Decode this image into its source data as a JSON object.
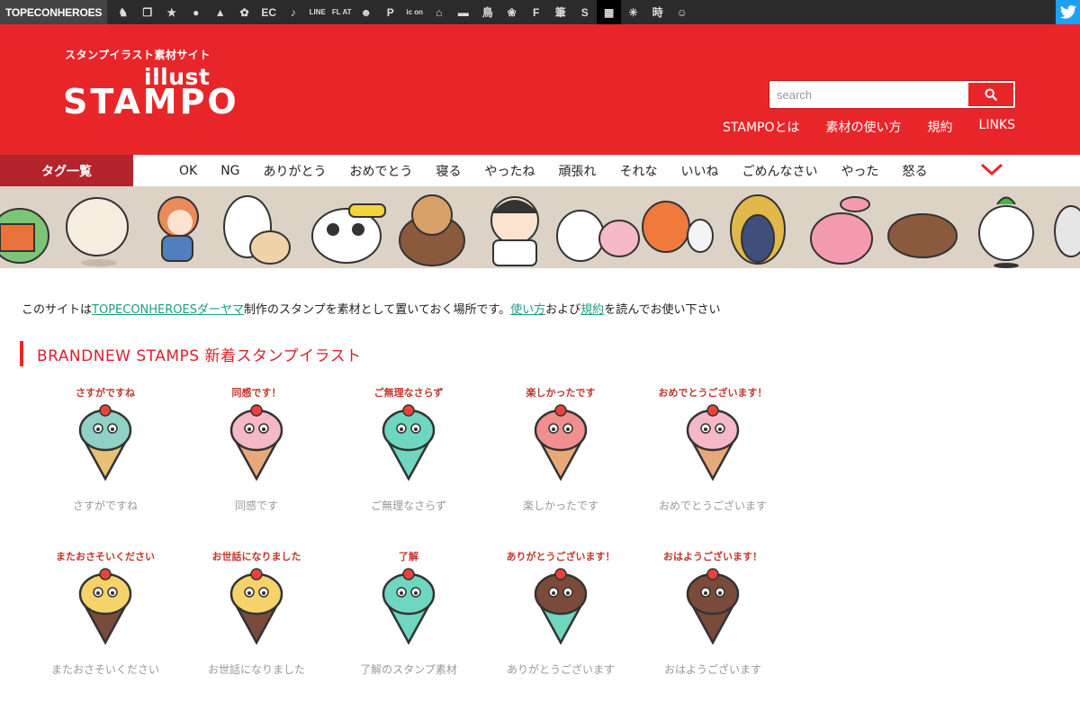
{
  "topbar": {
    "brand": "TOPECONHEROES",
    "site_icons": [
      {
        "icon": "animal-icon",
        "glyph": "♞"
      },
      {
        "icon": "copy-icon",
        "glyph": "❐"
      },
      {
        "icon": "person-icon",
        "glyph": "★"
      },
      {
        "icon": "speech-icon",
        "glyph": "●"
      },
      {
        "icon": "bird-icon",
        "glyph": "▲"
      },
      {
        "icon": "flower-icon",
        "glyph": "✿"
      },
      {
        "icon": "ec-icon",
        "glyph": "EC"
      },
      {
        "icon": "music-icon",
        "glyph": "♪"
      },
      {
        "icon": "line-icon",
        "glyph": "LINE"
      },
      {
        "icon": "flat-icon",
        "glyph": "FL AT"
      },
      {
        "icon": "smile-icon",
        "glyph": "☻"
      },
      {
        "icon": "parking-icon",
        "glyph": "P"
      },
      {
        "icon": "icon-text-icon",
        "glyph": "ic on"
      },
      {
        "icon": "building-icon",
        "glyph": "⌂"
      },
      {
        "icon": "train-icon",
        "glyph": "▬"
      },
      {
        "icon": "bird-kanji-icon",
        "glyph": "鳥"
      },
      {
        "icon": "flower-badge-icon",
        "glyph": "❀"
      },
      {
        "icon": "f-icon",
        "glyph": "F"
      },
      {
        "icon": "brush-icon",
        "glyph": "筆"
      },
      {
        "icon": "s-icon",
        "glyph": "S"
      },
      {
        "icon": "grid-icon",
        "glyph": "▦"
      },
      {
        "icon": "sparkle-icon",
        "glyph": "✳"
      },
      {
        "icon": "time-kanji-icon",
        "glyph": "時"
      },
      {
        "icon": "face-icon",
        "glyph": "☺"
      }
    ],
    "active_index": 20
  },
  "header": {
    "tagline": "スタンプイラスト素材サイト",
    "logo_small": "illust",
    "logo_large": "STAMPO",
    "search_placeholder": "search",
    "nav": [
      "STAMPOとは",
      "素材の使い方",
      "規約",
      "LINKS"
    ]
  },
  "tags": {
    "title": "タグ一覧",
    "items": [
      "OK",
      "NG",
      "ありがとう",
      "おめでとう",
      "寝る",
      "やったね",
      "頑張れ",
      "それな",
      "いいね",
      "ごめんなさい",
      "やった",
      "怒る"
    ]
  },
  "intro": {
    "before": "このサイトは",
    "link1": "TOPECONHEROESダーヤマ",
    "mid1": "制作のスタンプを素材として置いておく場所です。",
    "link2": "使い方",
    "mid2": "および",
    "link3": "規約",
    "after": "を読んでお使い下さい"
  },
  "section": {
    "title": "BRANDNEW STAMPS 新着スタンプイラスト"
  },
  "stamps": [
    {
      "caption": "さすがですね",
      "bubble": "さすがですね",
      "cream": "#8fd1c4",
      "cone": "#e8c07a"
    },
    {
      "caption": "同感です",
      "bubble": "同感です！",
      "cream": "#f5b8c6",
      "cone": "#e8a97a"
    },
    {
      "caption": "ご無理なさらず",
      "bubble": "ご無理なさらず",
      "cream": "#6fd6c0",
      "cone": "#6fd6c0"
    },
    {
      "caption": "楽しかったです",
      "bubble": "楽しかったです",
      "cream": "#f08f8f",
      "cone": "#e8a97a"
    },
    {
      "caption": "おめでとうございます",
      "bubble": "おめでとうございます！",
      "cream": "#f5b8c6",
      "cone": "#e8a97a"
    },
    {
      "caption": "またおさそいください",
      "bubble": "またおさそいください",
      "cream": "#f5d36a",
      "cone": "#7a4a3a"
    },
    {
      "caption": "お世話になりました",
      "bubble": "お世話になりました",
      "cream": "#f5d36a",
      "cone": "#7a4a3a"
    },
    {
      "caption": "了解のスタンプ素材",
      "bubble": "了解",
      "cream": "#6fd6c0",
      "cone": "#6fd6c0"
    },
    {
      "caption": "ありがとうございます",
      "bubble": "ありがとうございます！",
      "cream": "#7a4a3a",
      "cone": "#6fd6c0"
    },
    {
      "caption": "おはようございます",
      "bubble": "おはようございます！",
      "cream": "#7a4a3a",
      "cone": "#7a4a3a"
    }
  ],
  "colors": {
    "brand_red": "#e8262a",
    "tag_red": "#b5232c",
    "banner_bg": "#dcd2c6",
    "link_green": "#1f9d84",
    "twitter_blue": "#1da1f2"
  }
}
